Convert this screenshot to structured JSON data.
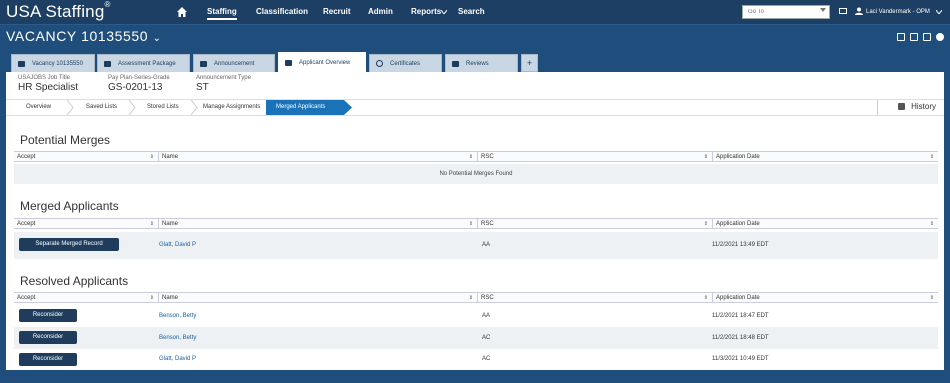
{
  "app": {
    "logo": "USA Staffing",
    "logo_mark": "®",
    "nav": [
      "Staffing",
      "Classification",
      "Recruit",
      "Admin",
      "Reports",
      "Search"
    ],
    "goto_placeholder": "Go To",
    "user": "Laci Vandermark - OPM"
  },
  "vacancy": {
    "title": "VACANCY 10135550",
    "caret": "⌄"
  },
  "tabs": [
    "Vacancy 10135550",
    "Assessment Package",
    "Announcement",
    "Applicant Overview",
    "Certificates",
    "Reviews"
  ],
  "tab_add": "+",
  "info": {
    "job_title_label": "USAJOBS Job Title",
    "job_title": "HR Specialist",
    "pay_label": "Pay Plan-Series-Grade",
    "pay": "GS-0201-13",
    "ann_type_label": "Announcement Type",
    "ann_type": "ST"
  },
  "crumbs": [
    "Overview",
    "Saved Lists",
    "Stored Lists",
    "Manage Assignments",
    "Merged Applicants"
  ],
  "history": "History",
  "columns": [
    "Accept",
    "Name",
    "RSC",
    "Application Date"
  ],
  "sort_glyph": "⇕",
  "potential": {
    "title": "Potential Merges",
    "empty": "No Potential Merges Found"
  },
  "merged": {
    "title": "Merged Applicants",
    "rows": [
      {
        "action": "Separate Merged Record",
        "name": "Glatt, David P",
        "rsc": "AA",
        "date": "11/2/2021 13:49 EDT"
      }
    ]
  },
  "resolved": {
    "title": "Resolved Applicants",
    "rows": [
      {
        "action": "Reconsider",
        "name": "Benson, Betty",
        "rsc": "AA",
        "date": "11/2/2021 18:47 EDT"
      },
      {
        "action": "Reconsider",
        "name": "Benson, Betty",
        "rsc": "AC",
        "date": "11/2/2021 18:48 EDT"
      },
      {
        "action": "Reconsider",
        "name": "Glatt, David P",
        "rsc": "AC",
        "date": "11/3/2021 10:49 EDT"
      }
    ]
  },
  "colors": {
    "header_bg": "#1d3f63",
    "page_bg": "#1f4e7c",
    "button": "#1f3c5c",
    "active_crumb": "#1a73b8",
    "link": "#1a5fa3"
  }
}
